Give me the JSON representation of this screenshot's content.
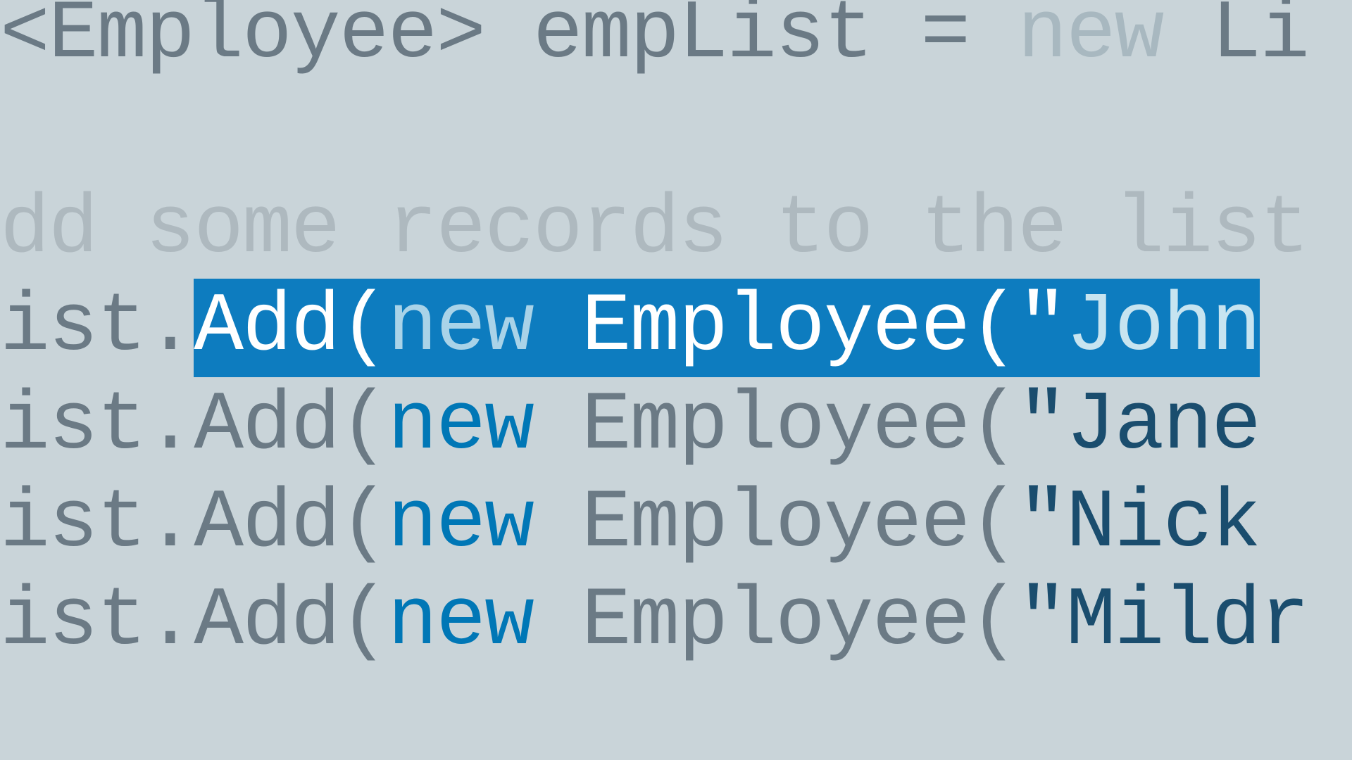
{
  "line1": {
    "prefix": "<Employee> empList = ",
    "keyword": "new",
    "suffix": " Li"
  },
  "line2_comment": "dd some records to the list",
  "highlighted": {
    "prefix": "ist.",
    "method": "Add(",
    "keyword": "new",
    "space": " ",
    "classname": "Employee(",
    "quote": "\"",
    "string": "John ",
    "pad": "                                              "
  },
  "lines": [
    {
      "prefix": "ist.",
      "method": "Add(",
      "keyword": "new",
      "space": " ",
      "classname": "Employee(",
      "quote": "\"",
      "string": "Jane "
    },
    {
      "prefix": "ist.",
      "method": "Add(",
      "keyword": "new",
      "space": " ",
      "classname": "Employee(",
      "quote": "\"",
      "string": "Nick "
    },
    {
      "prefix": "ist.",
      "method": "Add(",
      "keyword": "new",
      "space": " ",
      "classname": "Employee(",
      "quote": "\"",
      "string": "Mildr"
    }
  ]
}
